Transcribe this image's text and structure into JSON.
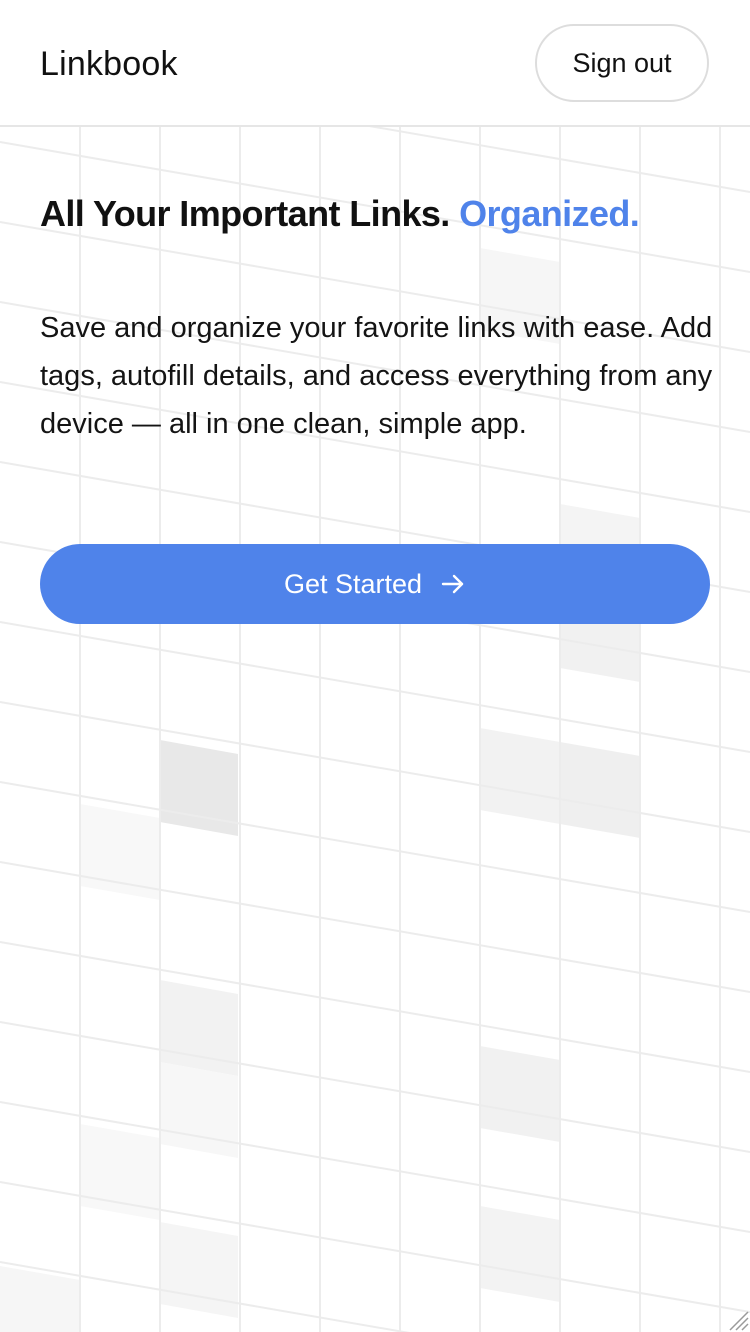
{
  "header": {
    "brand": "Linkbook",
    "signout_label": "Sign out"
  },
  "hero": {
    "headline": "All Your Important Links.",
    "headline_accent": "Organized.",
    "description": "Save and organize your favorite links with ease. Add tags, autofill details, and access everything from any device — all in one clean, simple app.",
    "cta_label": "Get Started",
    "cta_icon": "arrow-right-icon"
  },
  "colors": {
    "accent": "#4f83ea",
    "text": "#111111",
    "background": "#ffffff"
  }
}
